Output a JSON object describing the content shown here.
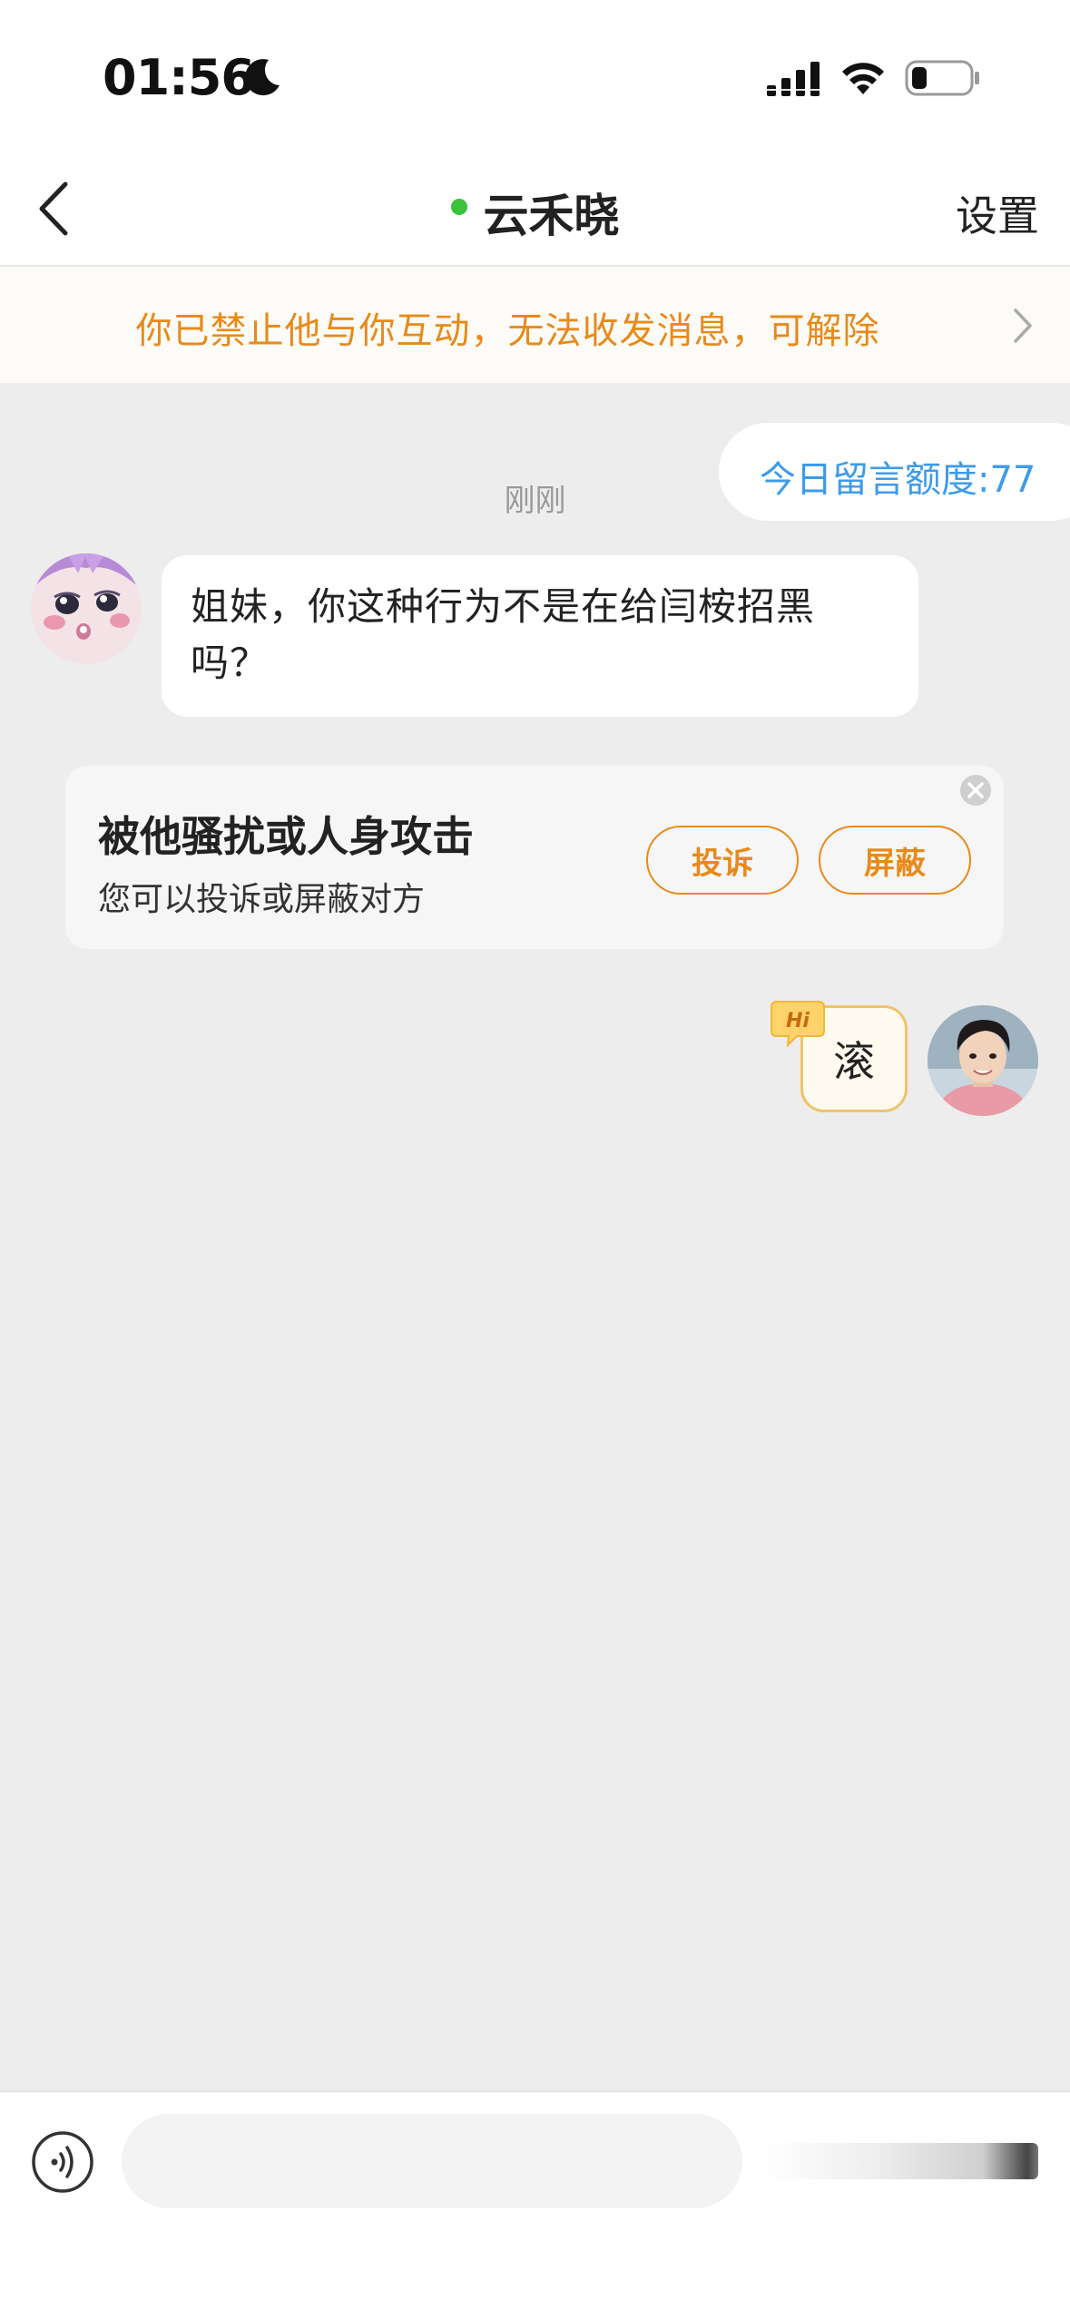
{
  "status_bar": {
    "time": "01:56"
  },
  "nav": {
    "title": "云禾晓",
    "settings_label": "设置"
  },
  "notice": {
    "text": "你已禁止他与你互动，无法收发消息，可解除"
  },
  "quota": {
    "text": "今日留言额度:77"
  },
  "chat": {
    "timestamp": "刚刚",
    "incoming_message": "姐妹，你这种行为不是在给闫桉招黑吗？",
    "outgoing_message": "滚",
    "hi_badge": "Hi"
  },
  "harassment_card": {
    "title": "被他骚扰或人身攻击",
    "subtitle": "您可以投诉或屏蔽对方",
    "report_label": "投诉",
    "block_label": "屏蔽"
  },
  "input": {
    "placeholder": ""
  },
  "colors": {
    "accent_orange": "#e88a1a",
    "quota_blue": "#3e9be9",
    "online_green": "#3cc23c",
    "background": "#ededed"
  }
}
